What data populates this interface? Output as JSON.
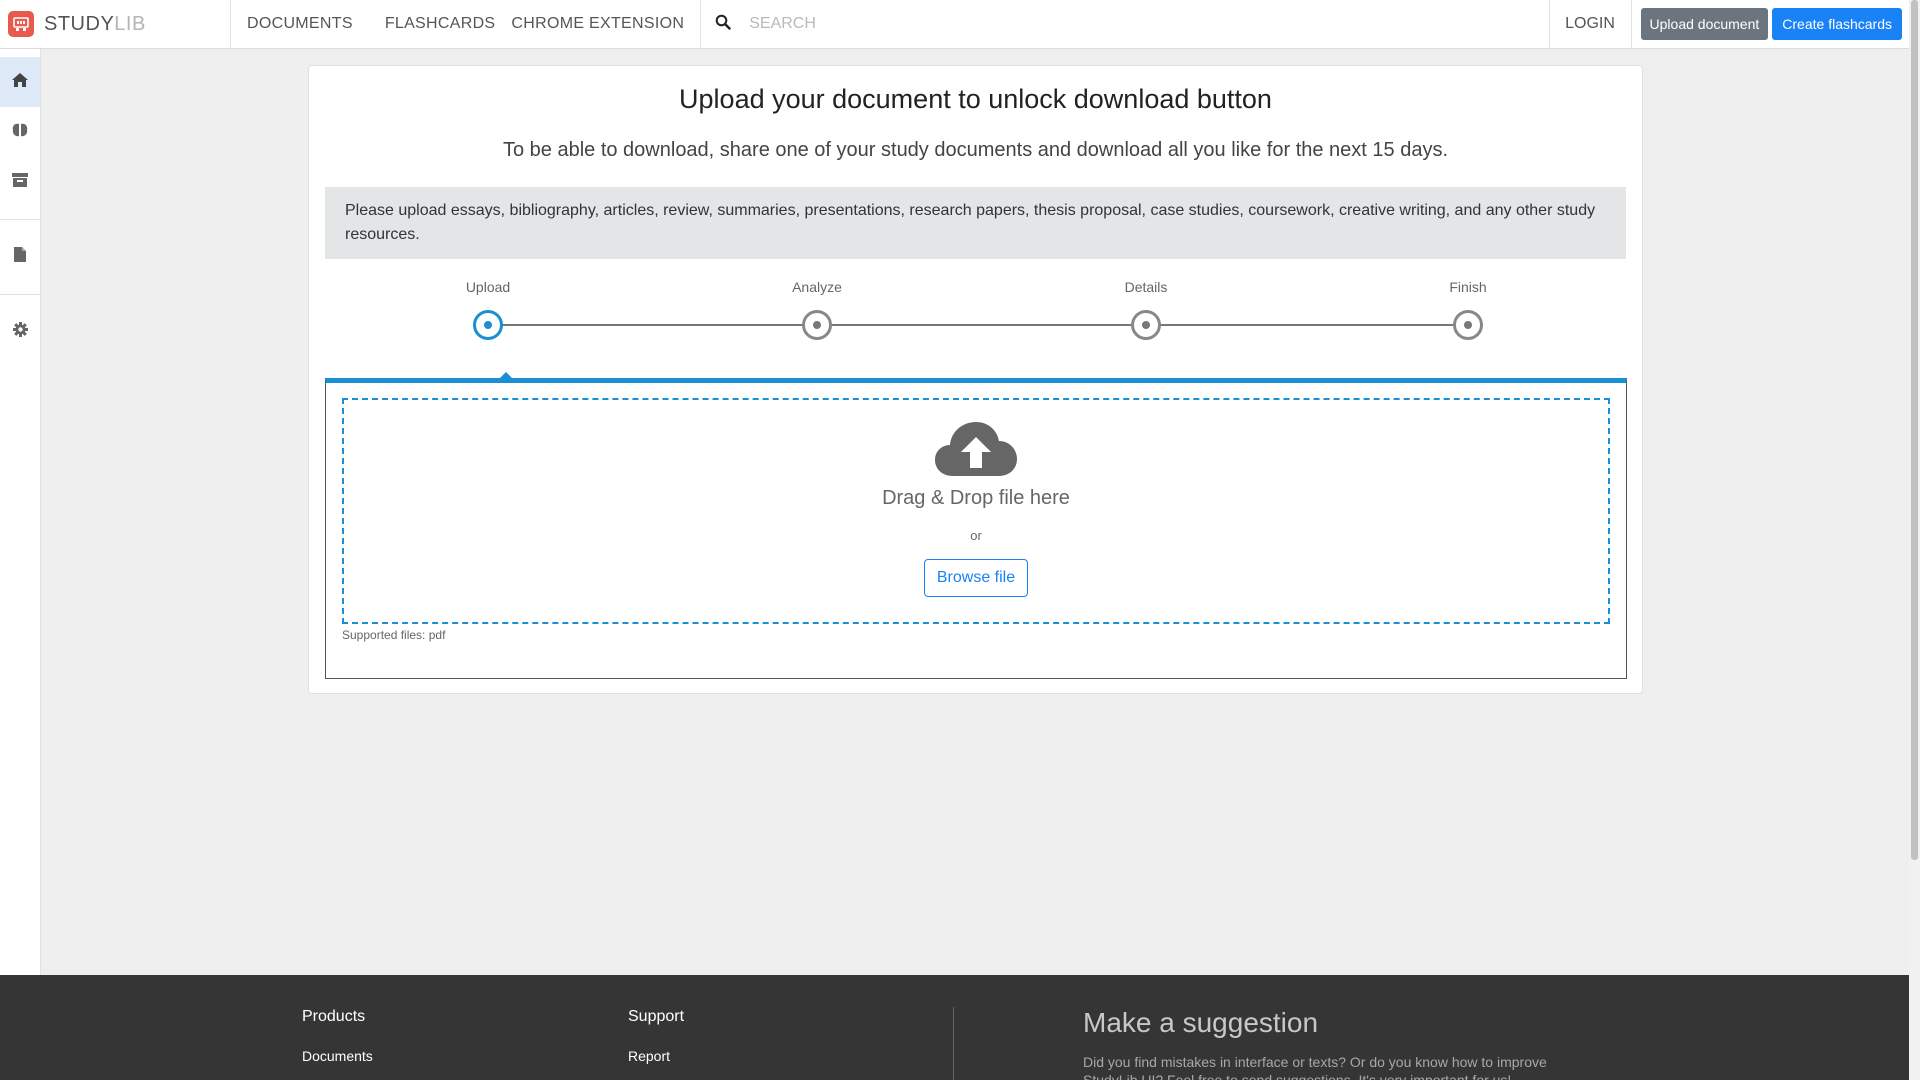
{
  "brand": {
    "name_primary": "STUDY",
    "name_secondary": "LIB",
    "logo_icon": "studylib-logo-icon",
    "logo_color": "#e8594e"
  },
  "nav": {
    "links": [
      "DOCUMENTS",
      "FLASHCARDS",
      "CHROME EXTENSION"
    ]
  },
  "search": {
    "icon": "search-icon",
    "placeholder": "SEARCH"
  },
  "header_actions": {
    "login": "LOGIN",
    "upload_document": "Upload document",
    "create_flashcards": "Create flashcards"
  },
  "sidebar": {
    "items": [
      {
        "icon": "home-icon",
        "active": true
      },
      {
        "icon": "brain-icon",
        "active": false
      },
      {
        "icon": "archive-icon",
        "active": false
      },
      {
        "icon": "document-icon",
        "active": false
      },
      {
        "icon": "gear-icon",
        "active": false
      }
    ]
  },
  "main": {
    "title": "Upload your document to unlock download button",
    "subtitle": "To be able to download, share one of your study documents and download all you like for the next 15 days.",
    "notice": "Please upload essays, bibliography, articles, review, summaries, presentations, research papers, thesis proposal, case studies, coursework, creative writing, and any other study resources.",
    "steps": [
      {
        "label": "Upload",
        "active": true
      },
      {
        "label": "Analyze",
        "active": false
      },
      {
        "label": "Details",
        "active": false
      },
      {
        "label": "Finish",
        "active": false
      }
    ],
    "dropzone": {
      "icon": "cloud-upload-icon",
      "title": "Drag & Drop file here",
      "or": "or",
      "browse": "Browse file",
      "supported": "Supported files: pdf"
    }
  },
  "footer": {
    "products": {
      "heading": "Products",
      "links": [
        "Documents"
      ]
    },
    "support": {
      "heading": "Support",
      "links": [
        "Report"
      ]
    },
    "suggestion": {
      "heading": "Make a suggestion",
      "text": "Did you find mistakes in interface or texts? Or do you know how to improve StudyLib UI? Feel free to send suggestions. It's very important for us!"
    }
  },
  "colors": {
    "accent": "#1a8fd6",
    "primary_button": "#1a82f7",
    "secondary_button": "#6c757d",
    "footer_bg": "#353535"
  }
}
